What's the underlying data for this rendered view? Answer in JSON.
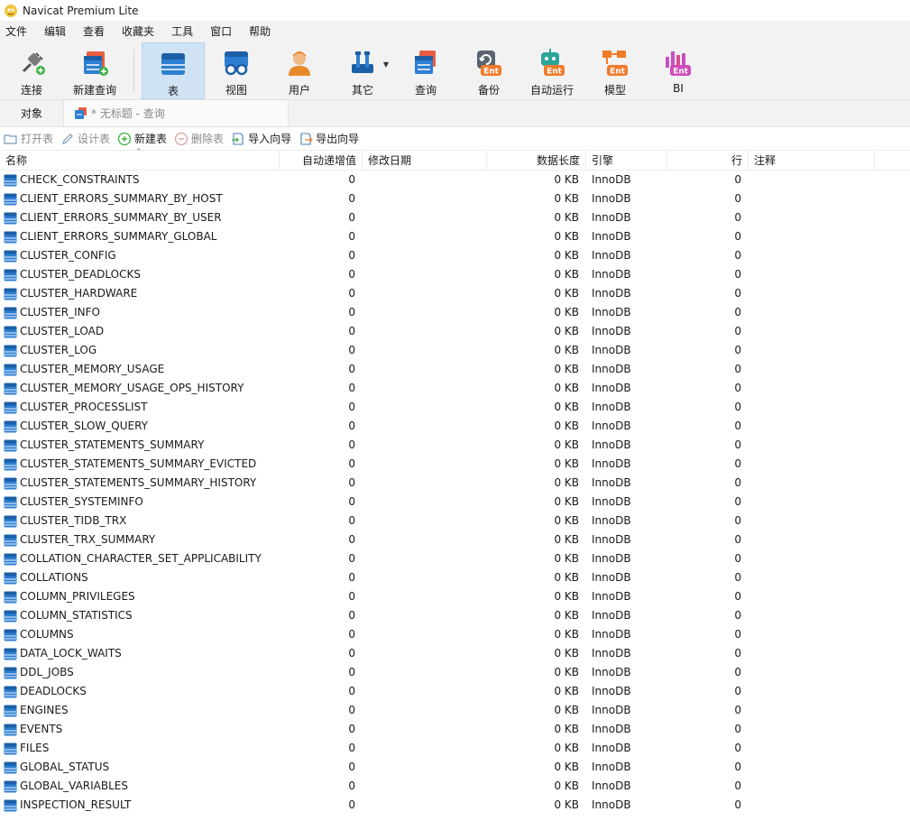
{
  "app": {
    "title": "Navicat Premium Lite"
  },
  "menu": [
    "文件",
    "编辑",
    "查看",
    "收藏夹",
    "工具",
    "窗口",
    "帮助"
  ],
  "toolbar": {
    "connect": "连接",
    "new_query": "新建查询",
    "table": "表",
    "view": "视图",
    "user": "用户",
    "other": "其它",
    "query": "查询",
    "backup": "备份",
    "automation": "自动运行",
    "model": "模型",
    "bi": "BI",
    "ent_badge": "Ent"
  },
  "tabs": {
    "objects": "对象",
    "query_tab": "* 无标题 - 查询"
  },
  "object_toolbar": {
    "open_table": "打开表",
    "design_table": "设计表",
    "new_table": "新建表",
    "delete_table": "删除表",
    "import_wizard": "导入向导",
    "export_wizard": "导出向导"
  },
  "columns": {
    "name": "名称",
    "auto_increment": "自动递增值",
    "modified": "修改日期",
    "data_length": "数据长度",
    "engine": "引擎",
    "rows": "行",
    "comment": "注释"
  },
  "rows": [
    {
      "name": "CHECK_CONSTRAINTS",
      "ai": "0",
      "len": "0 KB",
      "engine": "InnoDB",
      "rows": "0"
    },
    {
      "name": "CLIENT_ERRORS_SUMMARY_BY_HOST",
      "ai": "0",
      "len": "0 KB",
      "engine": "InnoDB",
      "rows": "0"
    },
    {
      "name": "CLIENT_ERRORS_SUMMARY_BY_USER",
      "ai": "0",
      "len": "0 KB",
      "engine": "InnoDB",
      "rows": "0"
    },
    {
      "name": "CLIENT_ERRORS_SUMMARY_GLOBAL",
      "ai": "0",
      "len": "0 KB",
      "engine": "InnoDB",
      "rows": "0"
    },
    {
      "name": "CLUSTER_CONFIG",
      "ai": "0",
      "len": "0 KB",
      "engine": "InnoDB",
      "rows": "0"
    },
    {
      "name": "CLUSTER_DEADLOCKS",
      "ai": "0",
      "len": "0 KB",
      "engine": "InnoDB",
      "rows": "0"
    },
    {
      "name": "CLUSTER_HARDWARE",
      "ai": "0",
      "len": "0 KB",
      "engine": "InnoDB",
      "rows": "0"
    },
    {
      "name": "CLUSTER_INFO",
      "ai": "0",
      "len": "0 KB",
      "engine": "InnoDB",
      "rows": "0"
    },
    {
      "name": "CLUSTER_LOAD",
      "ai": "0",
      "len": "0 KB",
      "engine": "InnoDB",
      "rows": "0"
    },
    {
      "name": "CLUSTER_LOG",
      "ai": "0",
      "len": "0 KB",
      "engine": "InnoDB",
      "rows": "0"
    },
    {
      "name": "CLUSTER_MEMORY_USAGE",
      "ai": "0",
      "len": "0 KB",
      "engine": "InnoDB",
      "rows": "0"
    },
    {
      "name": "CLUSTER_MEMORY_USAGE_OPS_HISTORY",
      "ai": "0",
      "len": "0 KB",
      "engine": "InnoDB",
      "rows": "0"
    },
    {
      "name": "CLUSTER_PROCESSLIST",
      "ai": "0",
      "len": "0 KB",
      "engine": "InnoDB",
      "rows": "0"
    },
    {
      "name": "CLUSTER_SLOW_QUERY",
      "ai": "0",
      "len": "0 KB",
      "engine": "InnoDB",
      "rows": "0"
    },
    {
      "name": "CLUSTER_STATEMENTS_SUMMARY",
      "ai": "0",
      "len": "0 KB",
      "engine": "InnoDB",
      "rows": "0"
    },
    {
      "name": "CLUSTER_STATEMENTS_SUMMARY_EVICTED",
      "ai": "0",
      "len": "0 KB",
      "engine": "InnoDB",
      "rows": "0"
    },
    {
      "name": "CLUSTER_STATEMENTS_SUMMARY_HISTORY",
      "ai": "0",
      "len": "0 KB",
      "engine": "InnoDB",
      "rows": "0"
    },
    {
      "name": "CLUSTER_SYSTEMINFO",
      "ai": "0",
      "len": "0 KB",
      "engine": "InnoDB",
      "rows": "0"
    },
    {
      "name": "CLUSTER_TIDB_TRX",
      "ai": "0",
      "len": "0 KB",
      "engine": "InnoDB",
      "rows": "0"
    },
    {
      "name": "CLUSTER_TRX_SUMMARY",
      "ai": "0",
      "len": "0 KB",
      "engine": "InnoDB",
      "rows": "0"
    },
    {
      "name": "COLLATION_CHARACTER_SET_APPLICABILITY",
      "ai": "0",
      "len": "0 KB",
      "engine": "InnoDB",
      "rows": "0"
    },
    {
      "name": "COLLATIONS",
      "ai": "0",
      "len": "0 KB",
      "engine": "InnoDB",
      "rows": "0"
    },
    {
      "name": "COLUMN_PRIVILEGES",
      "ai": "0",
      "len": "0 KB",
      "engine": "InnoDB",
      "rows": "0"
    },
    {
      "name": "COLUMN_STATISTICS",
      "ai": "0",
      "len": "0 KB",
      "engine": "InnoDB",
      "rows": "0"
    },
    {
      "name": "COLUMNS",
      "ai": "0",
      "len": "0 KB",
      "engine": "InnoDB",
      "rows": "0"
    },
    {
      "name": "DATA_LOCK_WAITS",
      "ai": "0",
      "len": "0 KB",
      "engine": "InnoDB",
      "rows": "0"
    },
    {
      "name": "DDL_JOBS",
      "ai": "0",
      "len": "0 KB",
      "engine": "InnoDB",
      "rows": "0"
    },
    {
      "name": "DEADLOCKS",
      "ai": "0",
      "len": "0 KB",
      "engine": "InnoDB",
      "rows": "0"
    },
    {
      "name": "ENGINES",
      "ai": "0",
      "len": "0 KB",
      "engine": "InnoDB",
      "rows": "0"
    },
    {
      "name": "EVENTS",
      "ai": "0",
      "len": "0 KB",
      "engine": "InnoDB",
      "rows": "0"
    },
    {
      "name": "FILES",
      "ai": "0",
      "len": "0 KB",
      "engine": "InnoDB",
      "rows": "0"
    },
    {
      "name": "GLOBAL_STATUS",
      "ai": "0",
      "len": "0 KB",
      "engine": "InnoDB",
      "rows": "0"
    },
    {
      "name": "GLOBAL_VARIABLES",
      "ai": "0",
      "len": "0 KB",
      "engine": "InnoDB",
      "rows": "0"
    },
    {
      "name": "INSPECTION_RESULT",
      "ai": "0",
      "len": "0 KB",
      "engine": "InnoDB",
      "rows": "0"
    }
  ]
}
